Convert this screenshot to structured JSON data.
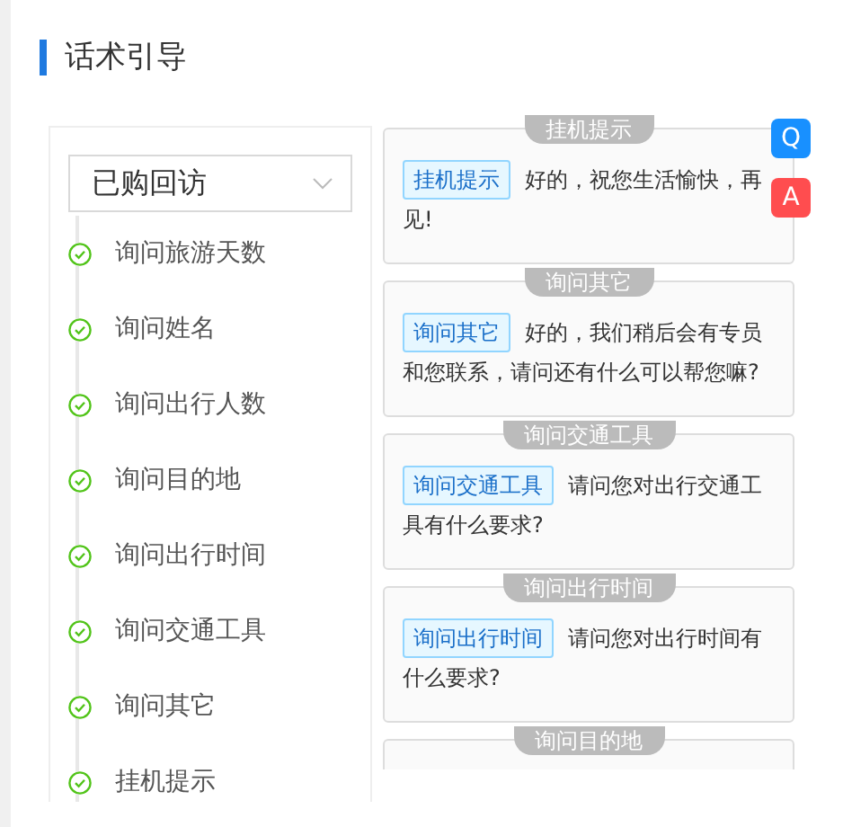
{
  "title": "话术引导",
  "select": {
    "value": "已购回访"
  },
  "steps": [
    {
      "label": "询问旅游天数",
      "done": true
    },
    {
      "label": "询问姓名",
      "done": true
    },
    {
      "label": "询问出行人数",
      "done": true
    },
    {
      "label": "询问目的地",
      "done": true
    },
    {
      "label": "询问出行时间",
      "done": true
    },
    {
      "label": "询问交通工具",
      "done": true
    },
    {
      "label": "询问其它",
      "done": true
    },
    {
      "label": "挂机提示",
      "done": true
    }
  ],
  "cards": [
    {
      "title": "挂机提示",
      "tag": "挂机提示",
      "text": "好的，祝您生活愉快，再见!"
    },
    {
      "title": "询问其它",
      "tag": "询问其它",
      "text": "好的，我们稍后会有专员和您联系，请问还有什么可以帮您嘛?"
    },
    {
      "title": "询问交通工具",
      "tag": "询问交通工具",
      "text": "请问您对出行交通工具有什么要求?"
    },
    {
      "title": "询问出行时间",
      "tag": "询问出行时间",
      "text": "请问您对出行时间有什么要求?"
    },
    {
      "title": "询问目的地"
    }
  ],
  "float_buttons": [
    {
      "label": "Q",
      "kind": "question"
    },
    {
      "label": "A",
      "kind": "answer"
    }
  ]
}
